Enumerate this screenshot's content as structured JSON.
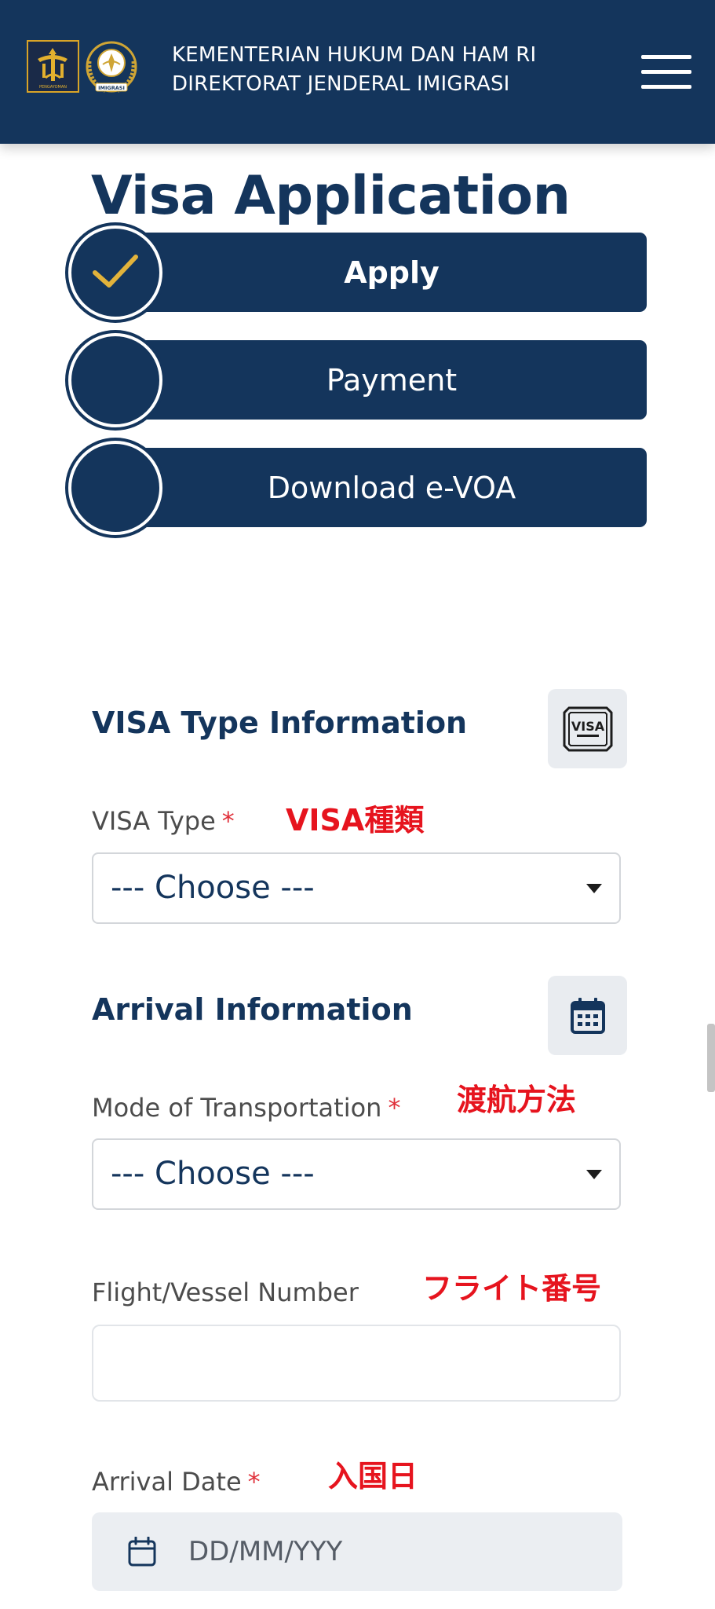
{
  "header": {
    "title_line1": "KEMENTERIAN HUKUM DAN HAM RI",
    "title_line2": "DIREKTORAT JENDERAL IMIGRASI",
    "logo1_text": "PENGAYOMAN",
    "logo2_text": "IMIGRASI",
    "menu_icon": "hamburger-menu-icon"
  },
  "page": {
    "title": "Visa Application"
  },
  "steps": [
    {
      "label": "Apply",
      "state": "done",
      "icon": "check-icon"
    },
    {
      "label": "Payment",
      "state": "pending"
    },
    {
      "label": "Download e-VOA",
      "state": "pending"
    }
  ],
  "visa_section": {
    "title": "VISA Type Information",
    "icon": "visa-card-icon",
    "icon_text": "VISA",
    "visa_type": {
      "label": "VISA Type",
      "required": "*",
      "annotation": "VISA種類",
      "value": "--- Choose ---"
    }
  },
  "arrival_section": {
    "title": "Arrival Information",
    "icon": "calendar-icon",
    "transport": {
      "label": "Mode of Transportation",
      "required": "*",
      "annotation": "渡航方法",
      "value": "--- Choose ---"
    },
    "flight": {
      "label": "Flight/Vessel Number",
      "annotation": "フライト番号",
      "value": ""
    },
    "arrival_date": {
      "label": "Arrival Date",
      "required": "*",
      "annotation": "入国日",
      "placeholder": "DD/MM/YYY"
    }
  },
  "colors": {
    "primary": "#14355c",
    "accent": "#e2b33b",
    "required": "#e0303a",
    "annotation": "#e6141e"
  }
}
